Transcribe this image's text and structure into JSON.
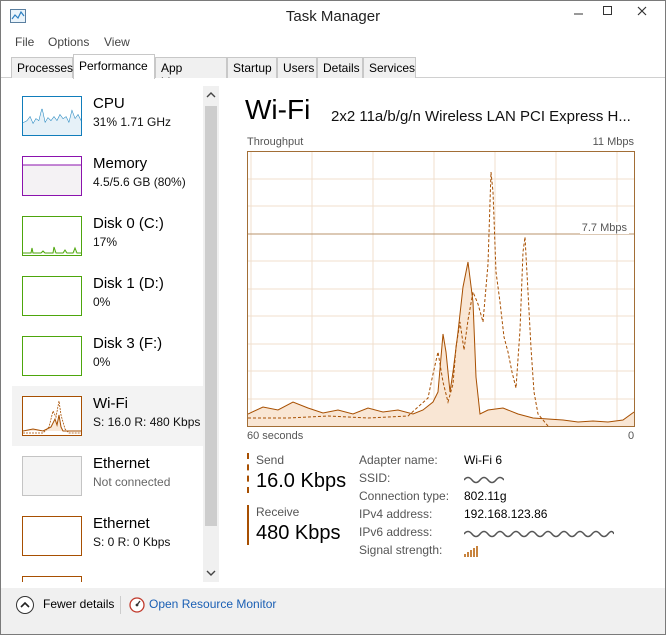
{
  "window": {
    "title": "Task Manager"
  },
  "menu": [
    "File",
    "Options",
    "View"
  ],
  "tabs": [
    "Processes",
    "Performance",
    "App history",
    "Startup",
    "Users",
    "Details",
    "Services"
  ],
  "active_tab": "Performance",
  "sidebar": {
    "items": [
      {
        "name": "CPU",
        "sub": "31% 1.71 GHz",
        "color": "#117dbb"
      },
      {
        "name": "Memory",
        "sub": "4.5/5.6 GB (80%)",
        "color": "#8b12ae"
      },
      {
        "name": "Disk 0 (C:)",
        "sub": "17%",
        "color": "#4da60c"
      },
      {
        "name": "Disk 1 (D:)",
        "sub": "0%",
        "color": "#4da60c"
      },
      {
        "name": "Disk 3 (F:)",
        "sub": "0%",
        "color": "#4da60c"
      },
      {
        "name": "Wi-Fi",
        "sub": "S: 16.0 R: 480 Kbps",
        "color": "#a74f01"
      },
      {
        "name": "Ethernet",
        "sub": "Not connected",
        "color": "#bbbbbb"
      },
      {
        "name": "Ethernet",
        "sub": "S: 0 R: 0 Kbps",
        "color": "#a74f01"
      }
    ]
  },
  "main": {
    "title": "Wi-Fi",
    "subtitle": "2x2 11a/b/g/n Wireless LAN PCI Express H...",
    "graph": {
      "label": "Throughput",
      "max": "11 Mbps",
      "mark": "7.7 Mbps",
      "time_left": "60 seconds",
      "time_right": "0"
    },
    "send": {
      "label": "Send",
      "value": "16.0 Kbps",
      "color": "#a74f01"
    },
    "receive": {
      "label": "Receive",
      "value": "480 Kbps",
      "color": "#a74f01"
    },
    "details": {
      "adapter_key": "Adapter name:",
      "adapter_val": "Wi-Fi 6",
      "ssid_key": "SSID:",
      "conn_key": "Connection type:",
      "conn_val": "802.11g",
      "ipv4_key": "IPv4 address:",
      "ipv4_val": "192.168.123.86",
      "ipv6_key": "IPv6 address:",
      "signal_key": "Signal strength:"
    }
  },
  "footer": {
    "fewer": "Fewer details",
    "resource": "Open Resource Monitor"
  }
}
